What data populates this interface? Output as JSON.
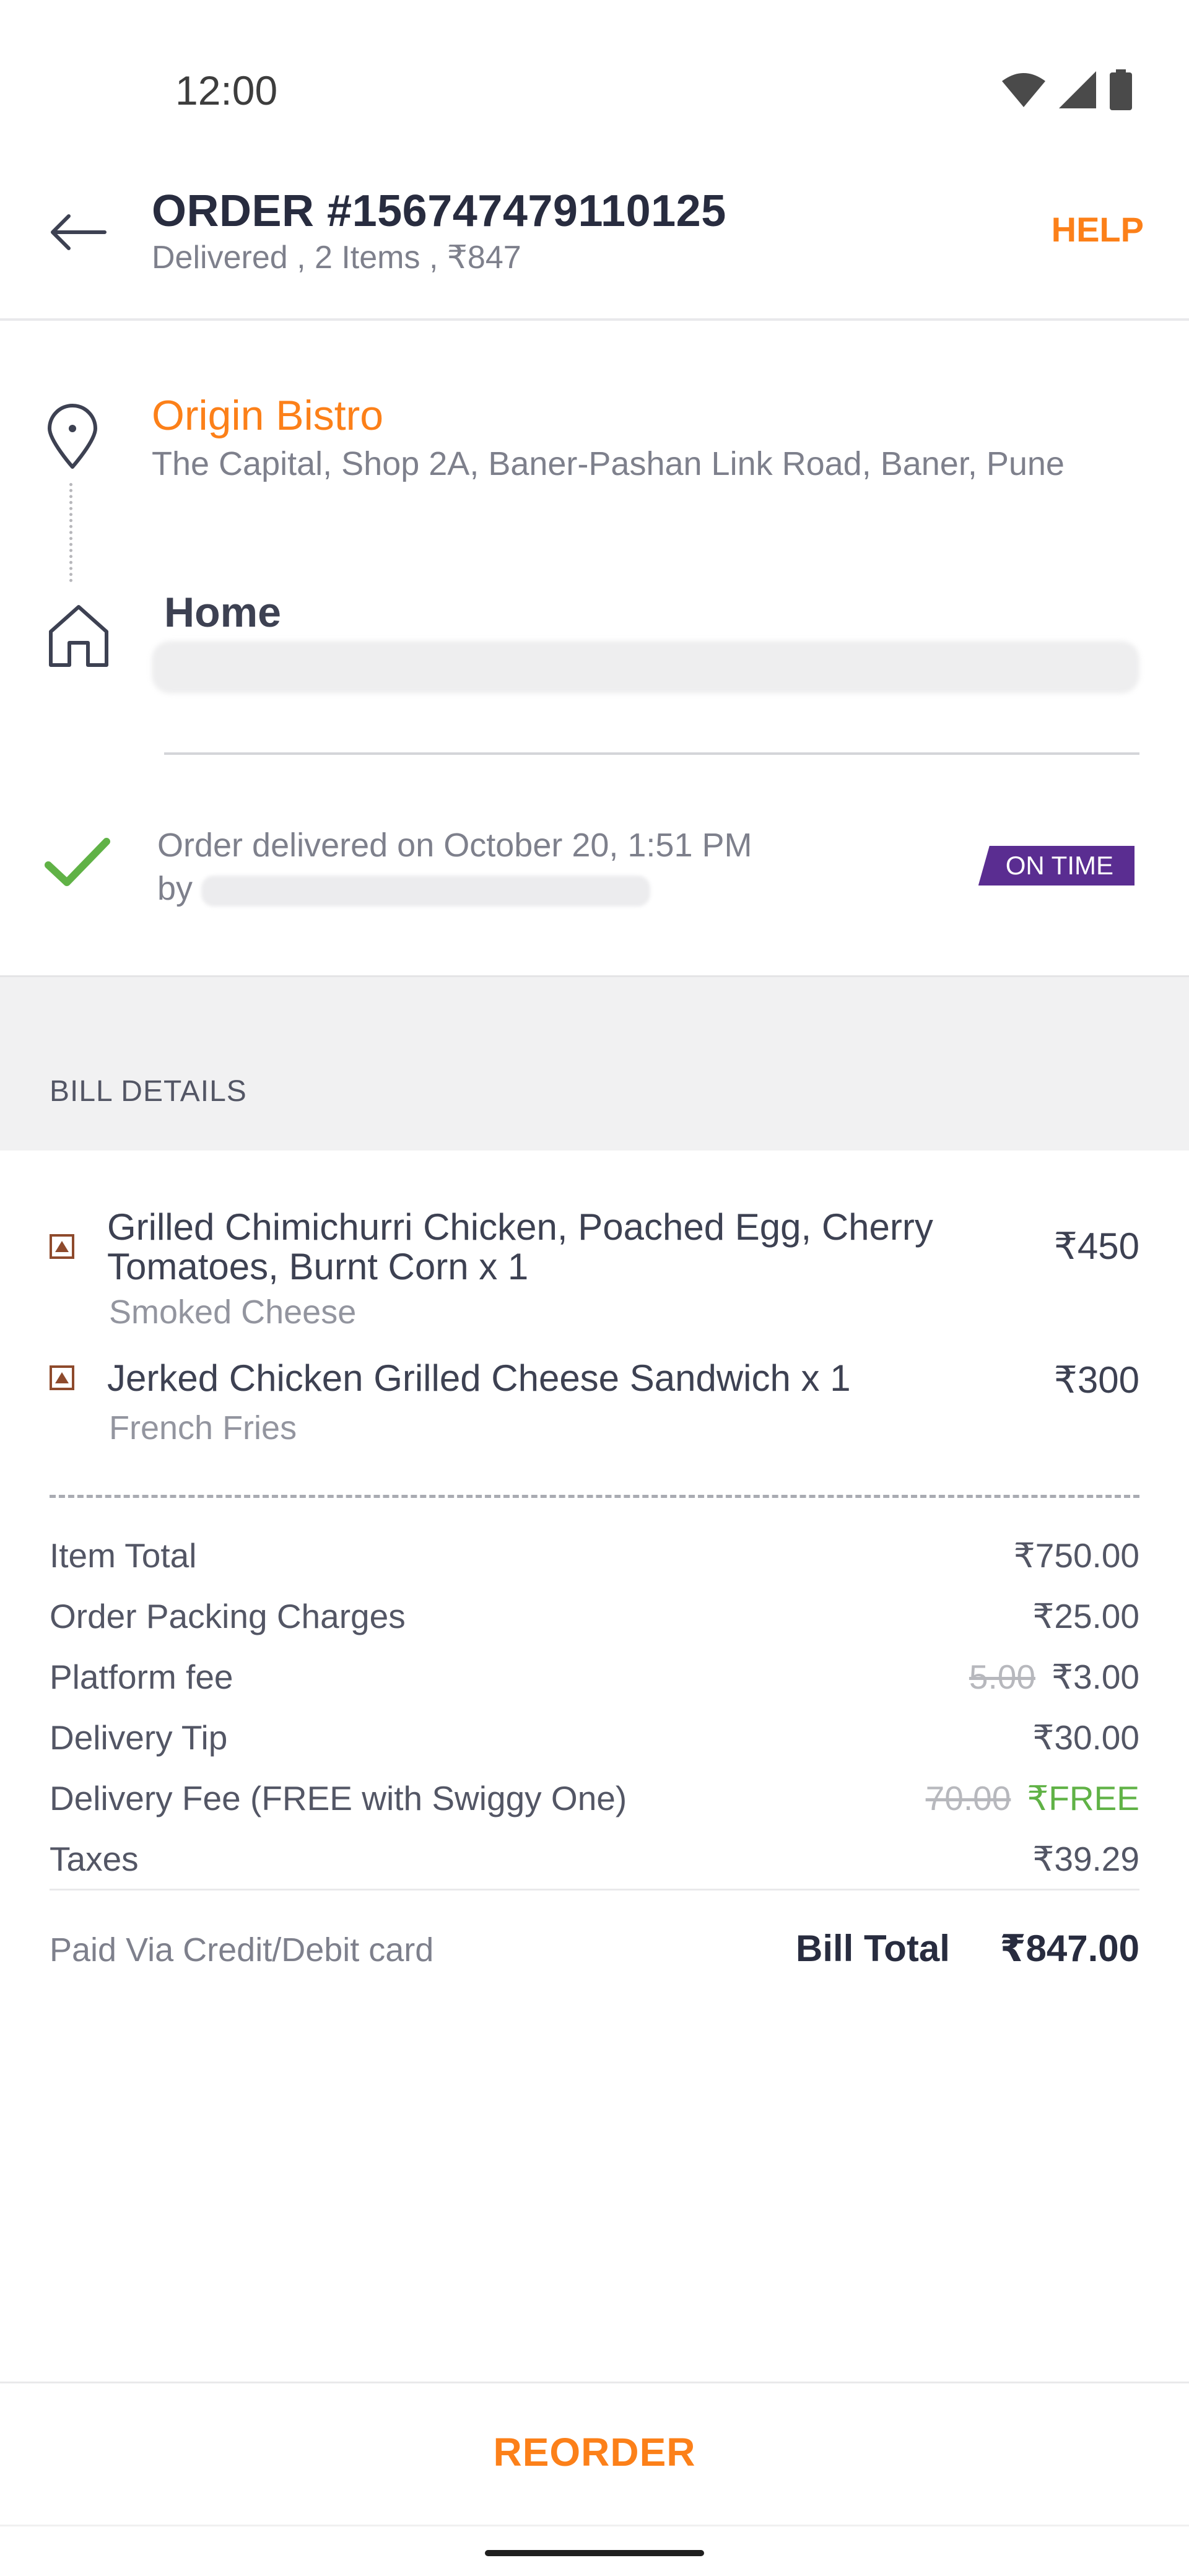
{
  "status_bar": {
    "time": "12:00",
    "icons": [
      "wifi-icon",
      "signal-icon",
      "battery-icon"
    ]
  },
  "header": {
    "title": "ORDER #156747479110125",
    "subtitle": "Delivered , 2 Items , ₹847",
    "help_label": "HELP"
  },
  "route": {
    "restaurant_name": "Origin Bistro",
    "restaurant_address": "The Capital, Shop 2A, Baner-Pashan Link Road, Baner, Pune",
    "destination_label": "Home"
  },
  "delivery": {
    "status_text": "Order delivered on October 20, 1:51 PM",
    "by_label": "by",
    "badge": "ON TIME"
  },
  "bill": {
    "heading": "BILL DETAILS",
    "items": [
      {
        "name": "Grilled Chimichurri Chicken, Poached Egg, Cherry Tomatoes, Burnt Corn x 1",
        "customization": "Smoked Cheese",
        "price": "₹450"
      },
      {
        "name": "Jerked Chicken Grilled Cheese Sandwich x 1",
        "customization": "French Fries",
        "price": "₹300"
      }
    ],
    "rows": [
      {
        "label": "Item Total",
        "value": "₹750.00",
        "original": ""
      },
      {
        "label": "Order Packing Charges",
        "value": "₹25.00",
        "original": ""
      },
      {
        "label": "Platform fee",
        "value": "₹3.00",
        "original": "5.00"
      },
      {
        "label": "Delivery Tip",
        "value": "₹30.00",
        "original": ""
      },
      {
        "label": "Delivery Fee (FREE with Swiggy One)",
        "value": "₹FREE",
        "original": "70.00"
      },
      {
        "label": "Taxes",
        "value": "₹39.29",
        "original": ""
      }
    ],
    "paid_via": "Paid Via Credit/Debit card",
    "total_label": "Bill Total",
    "total_value": "₹847.00"
  },
  "footer": {
    "reorder_label": "REORDER"
  },
  "colors": {
    "accent": "#fc8019",
    "on_time_badge": "#5a2d91",
    "free_green": "#60b246",
    "success_check": "#60b246"
  }
}
